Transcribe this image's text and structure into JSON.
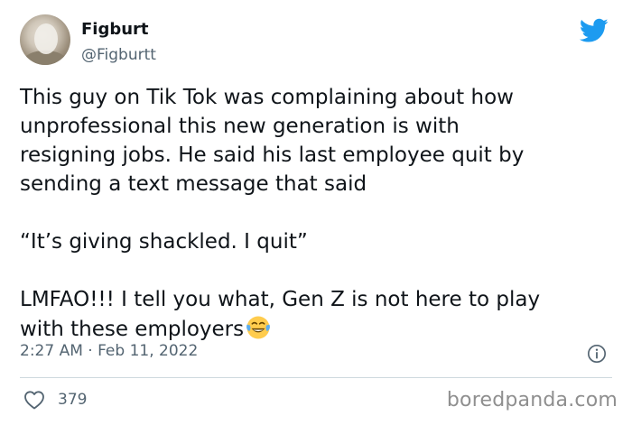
{
  "author": {
    "display_name": "Figburt",
    "handle": "@Figburtt"
  },
  "tweet": {
    "lines_p1": [
      "This guy on Tik Tok was complaining about how",
      "unprofessional this new generation is with",
      "resigning jobs. He said his last employee quit by",
      "sending a text message that said"
    ],
    "quote": "“It’s giving shackled. I quit”",
    "p3_line1": "LMFAO!!! I tell you what, Gen Z is not here to play",
    "p3_line2": "with these employers",
    "emoji": "face-with-tears-of-joy-icon"
  },
  "meta": {
    "timestamp": "2:27 AM · Feb 11, 2022",
    "likes": "379"
  },
  "watermark": "boredpanda.com",
  "colors": {
    "twitter_blue": "#1d9bf0",
    "secondary_text": "#536471",
    "primary_text": "#0f1419",
    "divider": "#cfd9de"
  }
}
